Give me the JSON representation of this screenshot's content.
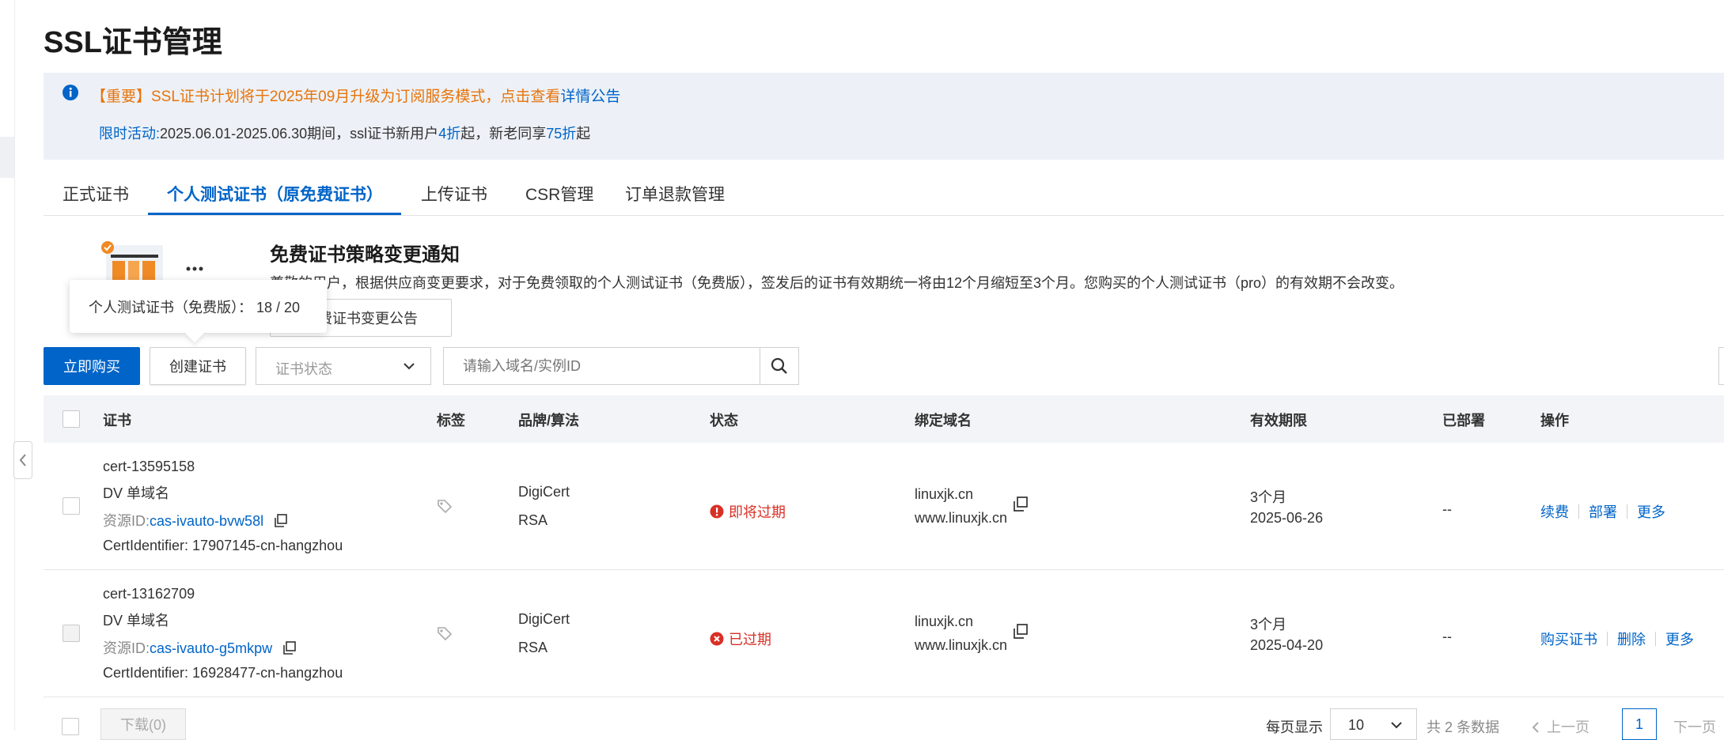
{
  "page_title": "SSL证书管理",
  "notice": {
    "line1_text": "【重要】SSL证书计划将于2025年09月升级为订阅服务模式，点击查看",
    "line1_link": "详情公告",
    "line2_lead": "限时活动:",
    "line2_part1": "2025.06.01-2025.06.30期间，ssl证书新用户",
    "line2_hl1": "4折",
    "line2_part2": "起，新老同享",
    "line2_hl2": "75折",
    "line2_part3": "起"
  },
  "tabs": [
    {
      "label": "正式证书"
    },
    {
      "label": "个人测试证书（原免费证书）"
    },
    {
      "label": "上传证书"
    },
    {
      "label": "CSR管理"
    },
    {
      "label": "订单退款管理"
    }
  ],
  "promo": {
    "title": "免费证书策略变更通知",
    "desc": "尊敬的用户，根据供应商变更要求，对于免费领取的个人测试证书（免费版），签发后的证书有效期统一将由12个月缩短至3个月。您购买的个人测试证书（pro）的有效期不会改变。",
    "button": "免费证书变更公告"
  },
  "tooltip": {
    "text": "个人测试证书（免费版）：  18 / 20"
  },
  "toolbar": {
    "buy": "立即购买",
    "create": "创建证书",
    "status_placeholder": "证书状态",
    "search_placeholder": "请输入域名/实例ID"
  },
  "table": {
    "headers": {
      "cert": "证书",
      "tag": "标签",
      "brand": "品牌/算法",
      "status": "状态",
      "domain": "绑定域名",
      "validity": "有效期限",
      "deployed": "已部署",
      "ops": "操作"
    },
    "rows": [
      {
        "name": "cert-13595158",
        "type": "DV 单域名",
        "resource_label": "资源ID:",
        "resource_id": "cas-ivauto-bvw58l",
        "identifier": "CertIdentifier: 17907145-cn-hangzhou",
        "brand": "DigiCert",
        "algo": "RSA",
        "status": "即将过期",
        "domain1": "linuxjk.cn",
        "domain2": "www.linuxjk.cn",
        "validity": "3个月",
        "expiry": "2025-06-26",
        "deployed": "--",
        "ops": [
          "续费",
          "部署",
          "更多"
        ]
      },
      {
        "name": "cert-13162709",
        "type": "DV 单域名",
        "resource_label": "资源ID:",
        "resource_id": "cas-ivauto-g5mkpw",
        "identifier": "CertIdentifier: 16928477-cn-hangzhou",
        "brand": "DigiCert",
        "algo": "RSA",
        "status": "已过期",
        "domain1": "linuxjk.cn",
        "domain2": "www.linuxjk.cn",
        "validity": "3个月",
        "expiry": "2025-04-20",
        "deployed": "--",
        "ops": [
          "购买证书",
          "删除",
          "更多"
        ]
      }
    ]
  },
  "footer": {
    "download": "下载(0)",
    "per_page_label": "每页显示",
    "per_page_value": "10",
    "total": "共 2 条数据",
    "prev": "上一页",
    "page": "1",
    "next": "下一页"
  },
  "colors": {
    "accent": "#0064c8",
    "warning": "#d93026",
    "notice_orange": "#e7740b"
  }
}
